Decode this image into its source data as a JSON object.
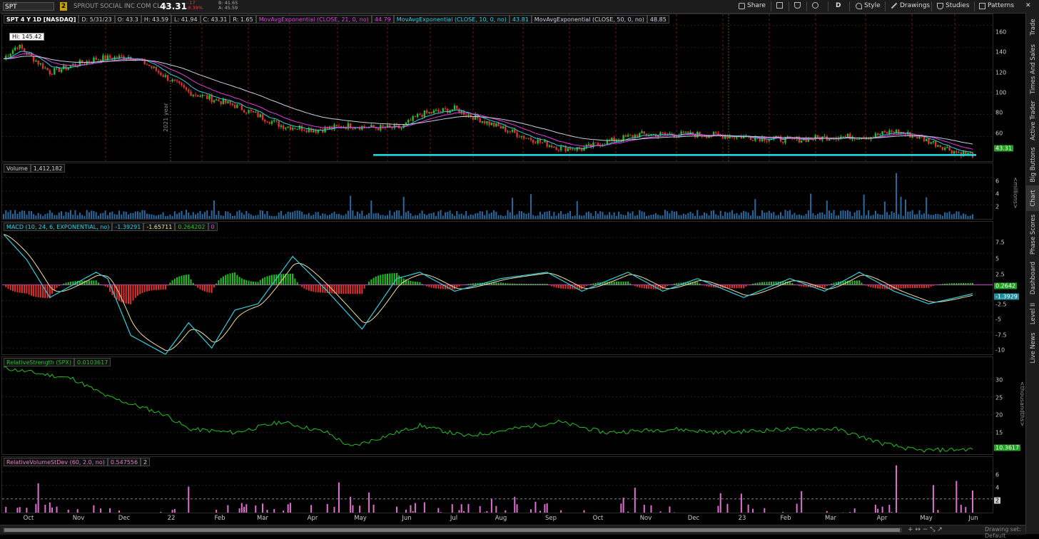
{
  "toolbar": {
    "symbol": "SPT",
    "link_badge": "2",
    "company": "SPROUT SOCIAL INC COM CL A",
    "last": "43.31",
    "change": "-.17",
    "change_pct": "-0.39%",
    "bid": "B: 41.65",
    "ask": "A: 45.59",
    "share": "Share",
    "period": "D",
    "style": "Style",
    "drawings": "Drawings",
    "studies": "Studies",
    "patterns": "Patterns"
  },
  "side_tabs": [
    "Trade",
    "Times And Sales",
    "Active Trader",
    "Big Buttons",
    "Chart",
    "Phase Scores",
    "Dashboard",
    "Level II",
    "Live News"
  ],
  "price_panel": {
    "header": "SPT 4 Y 1D [NASDAQ]",
    "date": "D: 5/31/23",
    "open": "O: 43.3",
    "high": "H: 43.59",
    "low": "L: 41.94",
    "close": "C: 43.31",
    "range": "R: 1.65",
    "ma21_label": "MovAvgExponential (CLOSE, 21, 0, no)",
    "ma21_val": "44.79",
    "ma10_label": "MovAvgExponential (CLOSE, 10, 0, no)",
    "ma10_val": "43.81",
    "ma50_label": "MovAvgExponential (CLOSE, 50, 0, no)",
    "ma50_val": "48.85",
    "hi_label": "Hi: 145.42",
    "yticks": [
      "160",
      "140",
      "120",
      "100",
      "80",
      "60"
    ],
    "last_box": "43.31",
    "year_label": "2021 year"
  },
  "volume_panel": {
    "label": "Volume",
    "value": "1,412,182",
    "yticks": [
      "6",
      "4",
      "2"
    ],
    "unit": "<millions>"
  },
  "macd_panel": {
    "label": "MACD (10, 24, 6, EXPONENTIAL, no)",
    "v1": "-1.39291",
    "v2": "-1.65711",
    "v3": "0.264202",
    "v4": "0",
    "yticks": [
      "7.5",
      "5",
      "2.5",
      "-2.5",
      "-5",
      "-7.5",
      "-10"
    ],
    "box_hist": "0.2642",
    "box_macd": "-1.3929"
  },
  "rs_panel": {
    "label": "RelativeStrength (SPX)",
    "value": "0.0103617",
    "yticks": [
      "30",
      "25",
      "20",
      "15"
    ],
    "unit": "<thousandths>",
    "last_box": "10.3617"
  },
  "rv_panel": {
    "label": "RelativeVolumeStDev (60, 2.0, no)",
    "value": "0.547556",
    "value2": "2",
    "yticks": [
      "6",
      "4"
    ],
    "box": "2"
  },
  "x_labels": [
    "Oct",
    "Nov",
    "Dec",
    "22",
    "Feb",
    "Mar",
    "Apr",
    "May",
    "Jun",
    "Jul",
    "Aug",
    "Sep",
    "Oct",
    "Nov",
    "Dec",
    "23",
    "Feb",
    "Mar",
    "Apr",
    "May",
    "Jun"
  ],
  "bottom": {
    "drawing_set": "Drawing set: Default"
  },
  "colors": {
    "up": "#22c022",
    "down": "#e03030",
    "ma21": "#e040e0",
    "ma10": "#30d0e0",
    "ma50": "#c8d0e0",
    "support": "#20e0e8"
  }
}
